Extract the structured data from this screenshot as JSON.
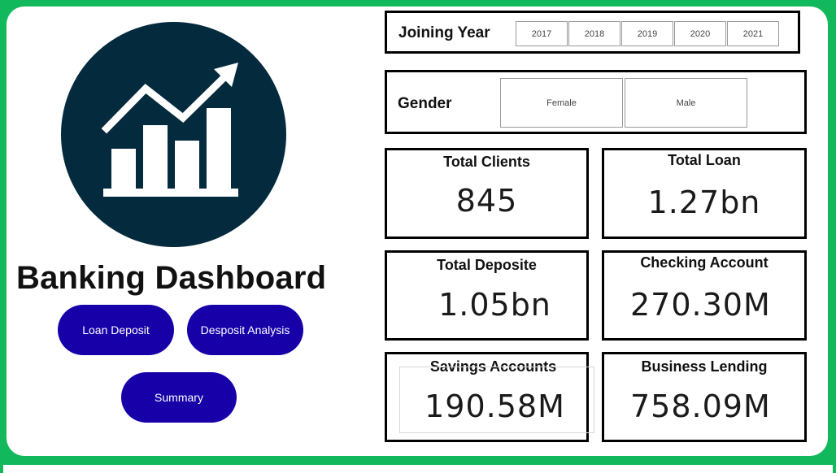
{
  "title": "Banking Dashboard",
  "logo_icon": "bar-chart-trend-up-icon",
  "colors": {
    "frame": "#12b95c",
    "logo_bg": "#032a3d",
    "button_bg": "#1800a8",
    "button_text": "#ffffff"
  },
  "nav": {
    "loan_deposit": "Loan Deposit",
    "deposit_analysis": "Desposit Analysis",
    "summary": "Summary"
  },
  "slicers": {
    "joining_year": {
      "label": "Joining Year",
      "options": [
        "2017",
        "2018",
        "2019",
        "2020",
        "2021"
      ]
    },
    "gender": {
      "label": "Gender",
      "options": [
        "Female",
        "Male"
      ]
    }
  },
  "kpis": {
    "total_clients": {
      "label": "Total Clients",
      "value": "845"
    },
    "total_loan": {
      "label": "Total Loan",
      "value": "1.27bn"
    },
    "total_deposite": {
      "label": "Total Deposite",
      "value": "1.05bn"
    },
    "checking_account": {
      "label": "Checking Account",
      "value": "270.30M"
    },
    "savings_accounts": {
      "label": "Savings Accounts",
      "value": "190.58M"
    },
    "business_lending": {
      "label": "Business Lending",
      "value": "758.09M"
    }
  }
}
